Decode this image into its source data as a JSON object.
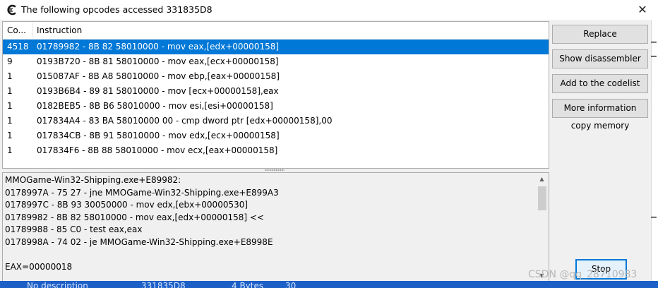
{
  "window": {
    "title": "The following opcodes accessed 331835D8",
    "close_glyph": "✕"
  },
  "list": {
    "columns": {
      "count": "Co...",
      "instruction": "Instruction"
    },
    "rows": [
      {
        "count": "4518",
        "instruction": "01789982 - 8B 82 58010000  - mov eax,[edx+00000158]",
        "selected": true
      },
      {
        "count": "9",
        "instruction": "0193B720 - 8B 81 58010000  - mov eax,[ecx+00000158]"
      },
      {
        "count": "1",
        "instruction": "015087AF - 8B A8 58010000  - mov ebp,[eax+00000158]"
      },
      {
        "count": "1",
        "instruction": "0193B6B4 - 89 81 58010000  - mov [ecx+00000158],eax"
      },
      {
        "count": "1",
        "instruction": "0182BEB5 - 8B B6 58010000  - mov esi,[esi+00000158]"
      },
      {
        "count": "1",
        "instruction": "017834A4 - 83 BA 58010000 00 - cmp dword ptr [edx+00000158],00"
      },
      {
        "count": "1",
        "instruction": "017834CB - 8B 91 58010000  - mov edx,[ecx+00000158]"
      },
      {
        "count": "1",
        "instruction": "017834F6 - 8B 88 58010000  - mov ecx,[eax+00000158]"
      }
    ]
  },
  "buttons": {
    "replace": "Replace",
    "show_disassembler": "Show disassembler",
    "add_to_codelist": "Add to the codelist",
    "more_information": "More information",
    "copy_memory": "copy memory",
    "stop": "Stop"
  },
  "disassembly": {
    "lines": [
      "MMOGame-Win32-Shipping.exe+E89982:",
      "0178997A - 75 27 - jne MMOGame-Win32-Shipping.exe+E899A3",
      "0178997C - 8B 93 30050000  - mov edx,[ebx+00000530]",
      "01789982 - 8B 82 58010000  - mov eax,[edx+00000158] <<",
      "01789988 - 85 C0  - test eax,eax",
      "0178998A - 74 02 - je MMOGame-Win32-Shipping.exe+E8998E",
      "",
      "EAX=00000018"
    ]
  },
  "watermark": "CSDN @qq_28710983",
  "background_table": {
    "description": "No description",
    "address": "331835D8",
    "type": "4 Bytes",
    "value": "30"
  },
  "colors": {
    "selection": "#0078d7",
    "button_face": "#e1e1e1",
    "default_button_border": "#0078d7",
    "background_table": "#1c5fc7"
  },
  "icons": {
    "app": "cheat-engine-icon",
    "close": "close-icon",
    "scroll_up": "scroll-up-icon",
    "scroll_down": "scroll-down-icon"
  }
}
